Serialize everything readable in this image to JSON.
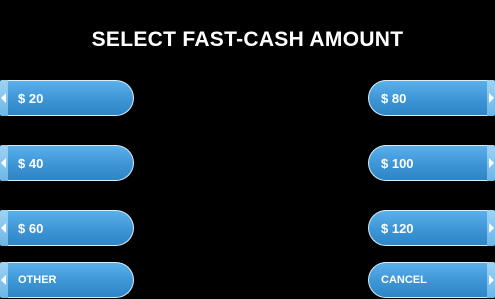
{
  "screen": {
    "title": "SELECT FAST-CASH AMOUNT"
  },
  "left_buttons": [
    {
      "label": "$ 20"
    },
    {
      "label": "$ 40"
    },
    {
      "label": "$ 60"
    },
    {
      "label": "OTHER"
    }
  ],
  "right_buttons": [
    {
      "label": "$ 80"
    },
    {
      "label": "$ 100"
    },
    {
      "label": "$ 120"
    },
    {
      "label": "CANCEL"
    }
  ],
  "colors": {
    "background": "#000000",
    "button_fill": "#3d95d6",
    "button_border": "#d9ecf9",
    "text": "#ffffff"
  },
  "icons": {
    "left_key_indicator": "caret-left-icon",
    "right_key_indicator": "caret-right-icon"
  }
}
